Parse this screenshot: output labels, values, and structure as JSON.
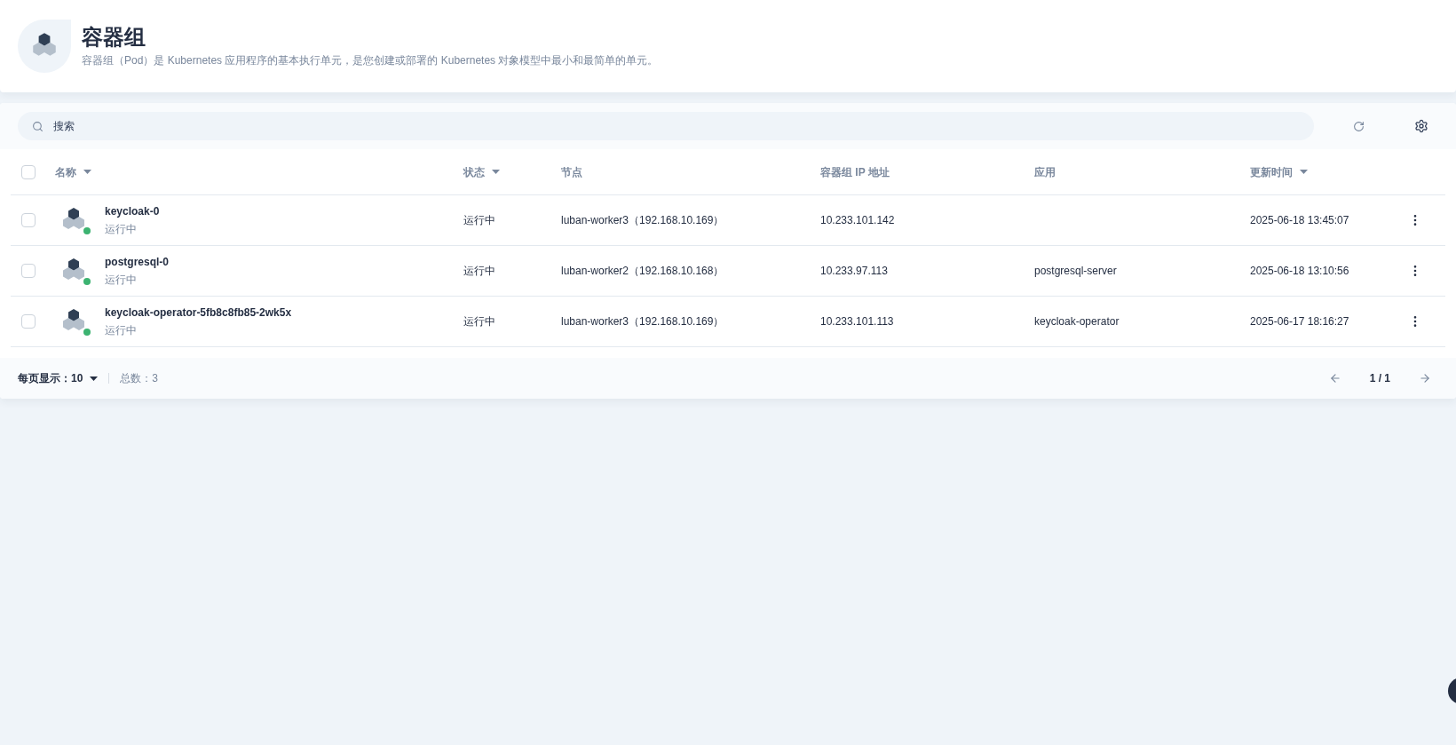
{
  "header": {
    "title": "容器组",
    "description": "容器组（Pod）是 Kubernetes 应用程序的基本执行单元，是您创建或部署的 Kubernetes 对象模型中最小和最简单的单元。"
  },
  "toolbar": {
    "search": {
      "placeholder": "搜索"
    }
  },
  "table": {
    "select_all": {
      "checked": false
    },
    "columns": [
      {
        "label": "名称",
        "sortable": true
      },
      {
        "label": "状态",
        "sortable": true
      },
      {
        "label": "节点",
        "sortable": false
      },
      {
        "label": "容器组 IP 地址",
        "sortable": false
      },
      {
        "label": "应用",
        "sortable": false
      },
      {
        "label": "更新时间",
        "sortable": true
      }
    ],
    "rows": [
      {
        "checked": false,
        "name": "keycloak-0",
        "status_text": "运行中",
        "color": "#3cb371",
        "status": "运行中",
        "node": "luban-worker3（192.168.10.169）",
        "ip": "10.233.101.142",
        "app": "",
        "updated": "2025-06-18 13:45:07"
      },
      {
        "checked": false,
        "name": "postgresql-0",
        "status_text": "运行中",
        "color": "#3cb371",
        "status": "运行中",
        "node": "luban-worker2（192.168.10.168）",
        "ip": "10.233.97.113",
        "app": "postgresql-server",
        "updated": "2025-06-18 13:10:56"
      },
      {
        "checked": false,
        "name": "keycloak-operator-5fb8c8fb85-2wk5x",
        "status_text": "运行中",
        "color": "#3cb371",
        "status": "运行中",
        "node": "luban-worker3（192.168.10.169）",
        "ip": "10.233.101.113",
        "app": "keycloak-operator",
        "updated": "2025-06-17 18:16:27"
      }
    ]
  },
  "footer": {
    "page_size_label": "每页显示：",
    "page_size": "10",
    "total": "总数：3",
    "page": "1 / 1"
  }
}
